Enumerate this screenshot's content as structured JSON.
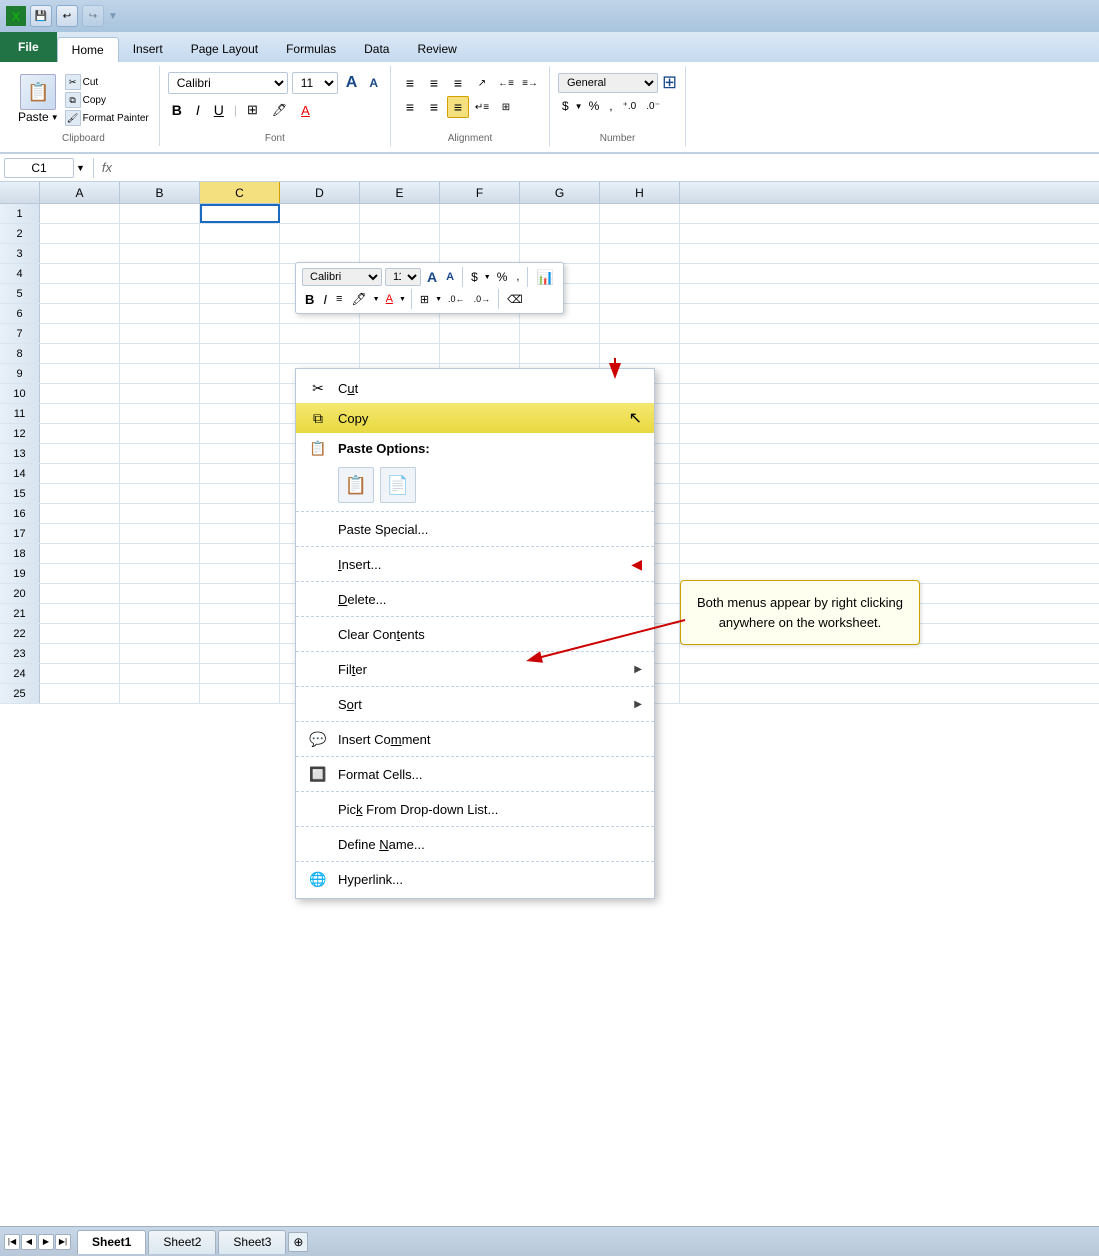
{
  "titlebar": {
    "icon": "X",
    "undo_label": "↩",
    "redo_label": "↪",
    "customize_label": "▼"
  },
  "tabs": {
    "file": "File",
    "home": "Home",
    "insert": "Insert",
    "page_layout": "Page Layout",
    "formulas": "Formulas",
    "data": "Data",
    "review": "Review"
  },
  "ribbon": {
    "clipboard_label": "Clipboard",
    "paste_label": "Paste",
    "cut_label": "Cut",
    "copy_label": "Copy",
    "format_painter_label": "Format Painter",
    "font_label": "Font",
    "font_name": "Calibri",
    "font_size": "11",
    "grow_label": "A",
    "shrink_label": "A",
    "bold_label": "B",
    "italic_label": "I",
    "underline_label": "U",
    "border_label": "⊞",
    "fill_label": "🖍",
    "color_label": "A",
    "alignment_label": "Alignment",
    "align_left": "≡",
    "align_center": "≡",
    "align_right": "≡",
    "align_top": "⊤",
    "align_middle": "⊥",
    "align_bottom": "⊥",
    "wrap_label": "↵",
    "merge_label": "⊞",
    "number_label": "Number",
    "number_format": "General",
    "currency_label": "$",
    "percent_label": "%",
    "comma_label": ",",
    "increase_decimal": ".0→",
    "decrease_decimal": "←.0"
  },
  "mini_toolbar": {
    "font_name": "Calibri",
    "font_size": "11",
    "grow_label": "A↑",
    "shrink_label": "A↓",
    "currency_label": "$",
    "percent_label": "%",
    "comma_label": ",",
    "cell_style_label": "=",
    "bold_label": "B",
    "italic_label": "I",
    "align_label": "≡",
    "fill_label": "A",
    "color_label": "A",
    "border_label": "⊞",
    "decrease_decimal": "-.0",
    "increase_decimal": "+.0",
    "eraser_label": "⌫"
  },
  "formula_bar": {
    "name_box": "C1",
    "arrow": "▼",
    "fx": "fx",
    "value": ""
  },
  "columns": [
    "A",
    "B",
    "C",
    "H"
  ],
  "rows": [
    1,
    2,
    3,
    4,
    5,
    6,
    7,
    8,
    9,
    10,
    11,
    12,
    13,
    14,
    15,
    16,
    17,
    18,
    19,
    20,
    21,
    22,
    23,
    24,
    25
  ],
  "context_menu": {
    "cut_label": "Cut",
    "copy_label": "Copy",
    "paste_options_label": "Paste Options:",
    "paste_special_label": "Paste Special...",
    "insert_label": "Insert...",
    "delete_label": "Delete...",
    "clear_contents_label": "Clear Contents",
    "filter_label": "Filter",
    "sort_label": "Sort",
    "insert_comment_label": "Insert Comment",
    "format_cells_label": "Format Cells...",
    "pick_from_list_label": "Pick From Drop-down List...",
    "define_name_label": "Define Name...",
    "hyperlink_label": "Hyperlink..."
  },
  "callout": {
    "text": "Both menus appear by right clicking anywhere on the worksheet."
  },
  "sheet_tabs": {
    "sheet1": "Sheet1",
    "sheet2": "Sheet2",
    "sheet3": "Sheet3"
  }
}
